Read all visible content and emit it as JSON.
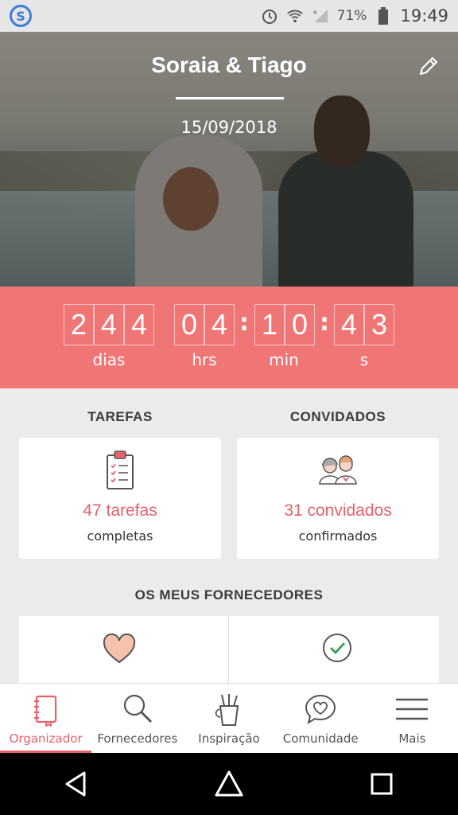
{
  "status_bar": {
    "battery_percent": "71%",
    "time": "19:49"
  },
  "hero": {
    "couple_name": "Soraia & Tiago",
    "date": "15/09/2018"
  },
  "countdown": {
    "days_digits": [
      "2",
      "4",
      "4"
    ],
    "hours_digits": [
      "0",
      "4"
    ],
    "minutes_digits": [
      "1",
      "0"
    ],
    "seconds_digits": [
      "4",
      "3"
    ],
    "separator": ":",
    "labels": {
      "days": "dias",
      "hours": "hrs",
      "minutes": "min",
      "seconds": "s"
    }
  },
  "tasks": {
    "title": "TAREFAS",
    "count": "47 tarefas",
    "sub": "completas"
  },
  "guests": {
    "title": "CONVIDADOS",
    "count": "31 convidados",
    "sub": "confirmados"
  },
  "suppliers": {
    "title": "OS MEUS FORNECEDORES"
  },
  "tabs": [
    {
      "label": "Organizador",
      "icon": "notebook-icon",
      "active": true
    },
    {
      "label": "Fornecedores",
      "icon": "search-icon",
      "active": false
    },
    {
      "label": "Inspiração",
      "icon": "pencil-cup-icon",
      "active": false
    },
    {
      "label": "Comunidade",
      "icon": "chat-heart-icon",
      "active": false
    },
    {
      "label": "Mais",
      "icon": "menu-icon",
      "active": false
    }
  ],
  "colors": {
    "accent": "#e8616b",
    "countdown_bg": "#f07676"
  }
}
